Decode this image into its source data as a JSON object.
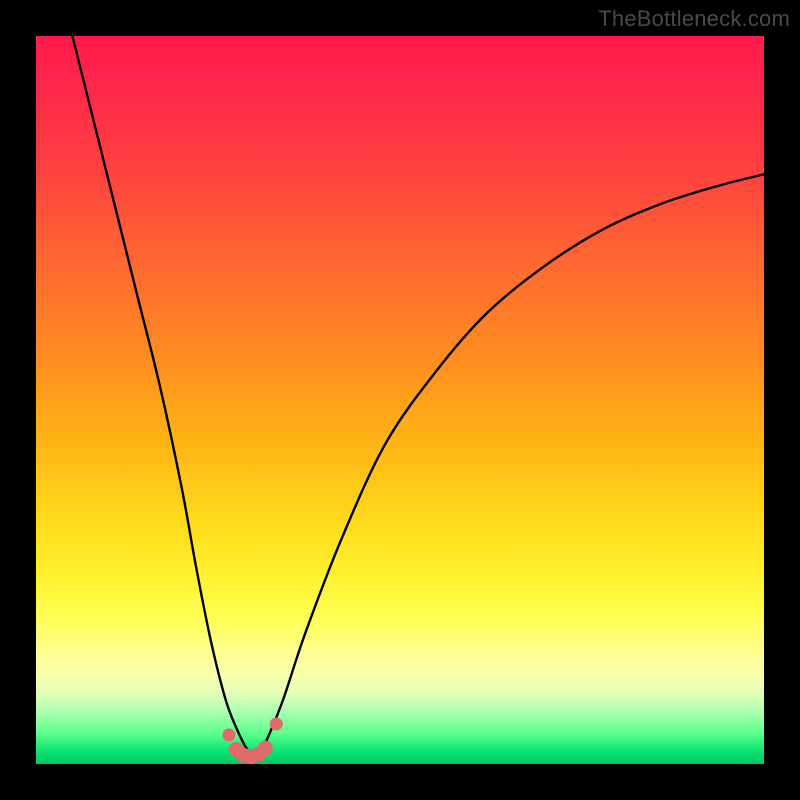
{
  "watermark": {
    "text": "TheBottleneck.com"
  },
  "colors": {
    "curve_stroke": "#000000",
    "marker_fill": "#e26a6a",
    "marker_stroke": "#c84f4f"
  },
  "chart_data": {
    "type": "line",
    "title": "",
    "xlabel": "",
    "ylabel": "",
    "xlim": [
      0,
      100
    ],
    "ylim": [
      0,
      100
    ],
    "grid": false,
    "legend": false,
    "series": [
      {
        "name": "bottleneck-curve",
        "x": [
          5,
          8,
          11,
          14,
          17,
          20,
          22,
          24,
          26,
          27.5,
          29,
          30,
          31,
          32,
          34,
          37,
          42,
          48,
          55,
          62,
          70,
          78,
          86,
          94,
          100
        ],
        "y": [
          100,
          88,
          76,
          64,
          52,
          38,
          27,
          17,
          9,
          5,
          2,
          1,
          2,
          4,
          9,
          18,
          31,
          44,
          54,
          62,
          68.5,
          73.5,
          77,
          79.5,
          81
        ]
      }
    ],
    "markers": {
      "name": "near-zero-cluster",
      "x": [
        26.5,
        27.5,
        28.5,
        29.5,
        30.5,
        31.5,
        33
      ],
      "y": [
        4.0,
        2.0,
        1.2,
        1.0,
        1.3,
        2.2,
        5.5
      ]
    }
  }
}
